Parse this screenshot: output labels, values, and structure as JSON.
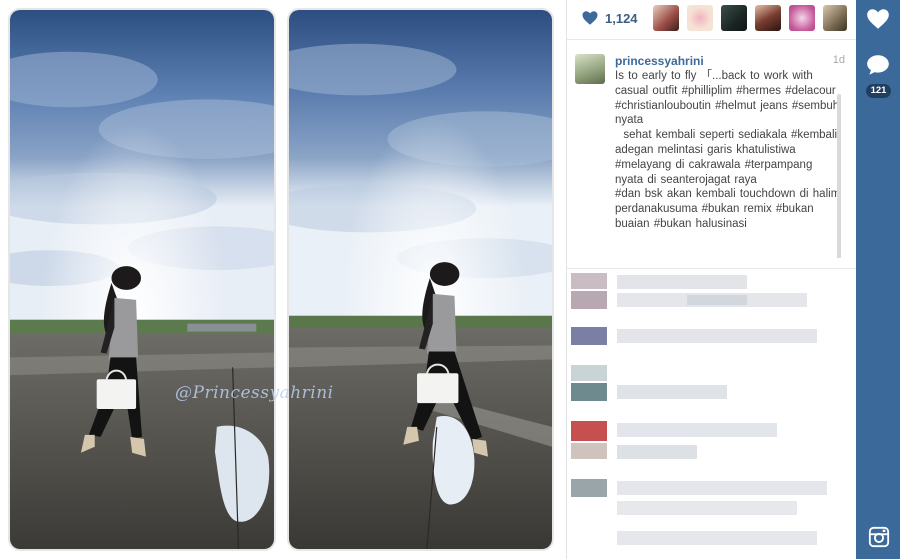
{
  "post": {
    "likes_count": "1,124",
    "username": "princessyahrini",
    "time_ago": "1d",
    "caption": "Is to early to fly 「...back to work with casual outfit #philliplim #hermes #delacour #christianlouboutin #helmut jeans #sembuh nyata\n  sehat kembali seperti sediakala #kembali adegan melintasi garis khatulistiwa #melayang di cakrawala #terpampang nyata di seanterojagat raya\n#dan bsk akan kembali touchdown di halim perdanakusuma #bukan remix #bukan buaian #bukan halusinasi",
    "watermark": "@Princessyahrini"
  },
  "rail": {
    "comment_count": "121"
  },
  "icons": {
    "like": "heart-icon",
    "comment": "comment-bubble-icon",
    "instagram": "instagram-camera-icon"
  },
  "colors": {
    "rail": "#3b6a9a",
    "username": "#3d6a99",
    "like_count": "#3d5f82"
  }
}
